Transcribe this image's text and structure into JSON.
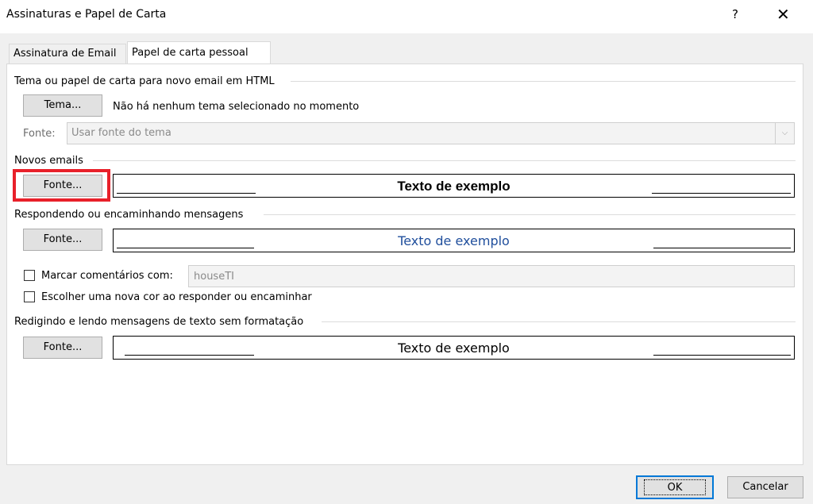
{
  "window": {
    "title": "Assinaturas e Papel de Carta",
    "help_label": "?",
    "close_label": "✕"
  },
  "tabs": [
    {
      "label": "Assinatura de Email",
      "selected": false
    },
    {
      "label": "Papel de carta pessoal",
      "selected": true
    }
  ],
  "theme_section": {
    "header": "Tema ou papel de carta para novo email em HTML",
    "theme_button": "Tema...",
    "theme_status": "Não há nenhum tema selecionado no momento",
    "font_label": "Fonte:",
    "font_value": "Usar fonte do tema"
  },
  "new_emails": {
    "header": "Novos emails",
    "font_button": "Fonte...",
    "sample_text": "Texto de exemplo"
  },
  "replying": {
    "header": "Respondendo ou encaminhando mensagens",
    "font_button": "Fonte...",
    "sample_text": "Texto de exemplo",
    "sample_color": "#1f4e9c",
    "mark_comments_label": "Marcar comentários com:",
    "mark_comments_checked": false,
    "mark_comments_value": "houseTI",
    "new_color_label": "Escolher uma nova cor ao responder ou encaminhar",
    "new_color_checked": false
  },
  "plain_text": {
    "header": "Redigindo e lendo mensagens de texto sem formatação",
    "font_button": "Fonte...",
    "sample_text": "Texto de exemplo"
  },
  "footer": {
    "ok_label": "OK",
    "cancel_label": "Cancelar"
  },
  "colors": {
    "accent": "#0078d7",
    "highlight": "#e8202a"
  }
}
